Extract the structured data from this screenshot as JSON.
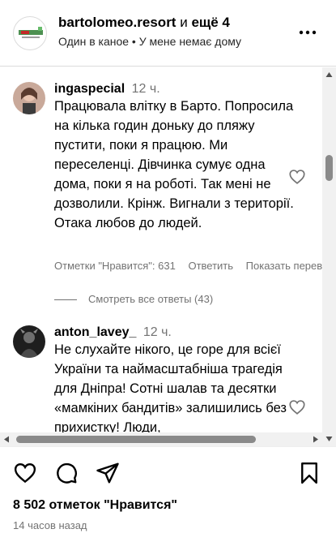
{
  "header": {
    "account": "bartolomeo.resort",
    "connector": "и",
    "others": "ещё 4",
    "subtitle": "Один в каное • У мене немає дому"
  },
  "comments": [
    {
      "username": "ingaspecial",
      "time": "12 ч.",
      "text": "Працювала влітку в Барто. Попросила на кілька годин доньку до пляжу пустити, поки я працюю. Ми переселенці. Дівчинка сумує одна дома, поки я на роботі. Так мені не дозволили. Крінж. Вигнали з території. Отака любов до людей.",
      "likes_label": "Отметки \"Нравится\": 631",
      "reply_label": "Ответить",
      "translate_label": "Показать перевод",
      "view_replies": "Смотреть все ответы (43)"
    },
    {
      "username": "anton_lavey_",
      "time": "12 ч.",
      "text": "Не слухайте нікого, це горе для всієї України та наймасштабніша трагедія для Дніпра! Сотні шалав та десятки «мамкіних бандитів» залишились без прихистку! Люди,"
    }
  ],
  "post": {
    "likes": "8 502 отметок \"Нравится\"",
    "timestamp": "14 часов назад"
  },
  "icons": {
    "like": "heart-icon",
    "comment": "comment-bubble-icon",
    "share": "paper-plane-icon",
    "save": "bookmark-icon",
    "more": "more-dots-icon"
  }
}
